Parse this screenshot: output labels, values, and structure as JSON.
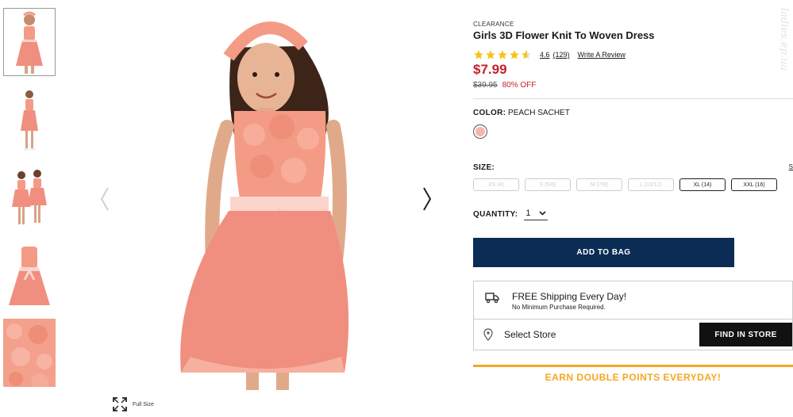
{
  "gallery": {
    "thumbnails": [
      "girl-front-thumbnail",
      "girl-full-body-thumbnail",
      "two-girls-thumbnail",
      "dress-flat-thumbnail",
      "fabric-detail-thumbnail"
    ],
    "full_size_label": "Full Size",
    "dress_color": "#f08f7f",
    "bodice_color": "#f49b86",
    "sash_color": "#fbd4cc"
  },
  "product": {
    "eyebrow": "CLEARANCE",
    "title": "Girls 3D Flower Knit To Woven Dress",
    "rating": "4.6",
    "rating_value": 4.6,
    "review_count": "(129)",
    "write_review": "Write A Review",
    "price": "$7.99",
    "old_price": "$39.95",
    "discount": "80% OFF",
    "color_label": "COLOR:",
    "color_value": "PEACH SACHET",
    "size_label": "SIZE:",
    "size_guide": "S",
    "sizes": [
      {
        "label": "XS (4)",
        "available": false
      },
      {
        "label": "S (5/6)",
        "available": false
      },
      {
        "label": "M (7/8)",
        "available": false
      },
      {
        "label": "L (10/12)",
        "available": false
      },
      {
        "label": "XL (14)",
        "available": true
      },
      {
        "label": "XXL (16)",
        "available": true
      }
    ],
    "quantity_label": "QUANTITY:",
    "quantity_value": "1",
    "add_to_bag": "ADD TO BAG",
    "shipping_title": "FREE Shipping Every Day!",
    "shipping_sub": "No Minimum Purchase Required.",
    "select_store": "Select Store",
    "find_in_store": "FIND IN STORE",
    "points_banner": "EARN DOUBLE POINTS EVERYDAY!"
  },
  "colors": {
    "price_red": "#c3212c",
    "navy": "#0b2c55",
    "star_gold": "#f5c518",
    "points_orange": "#f5a623"
  },
  "watermark": "ladies.ep.ua"
}
